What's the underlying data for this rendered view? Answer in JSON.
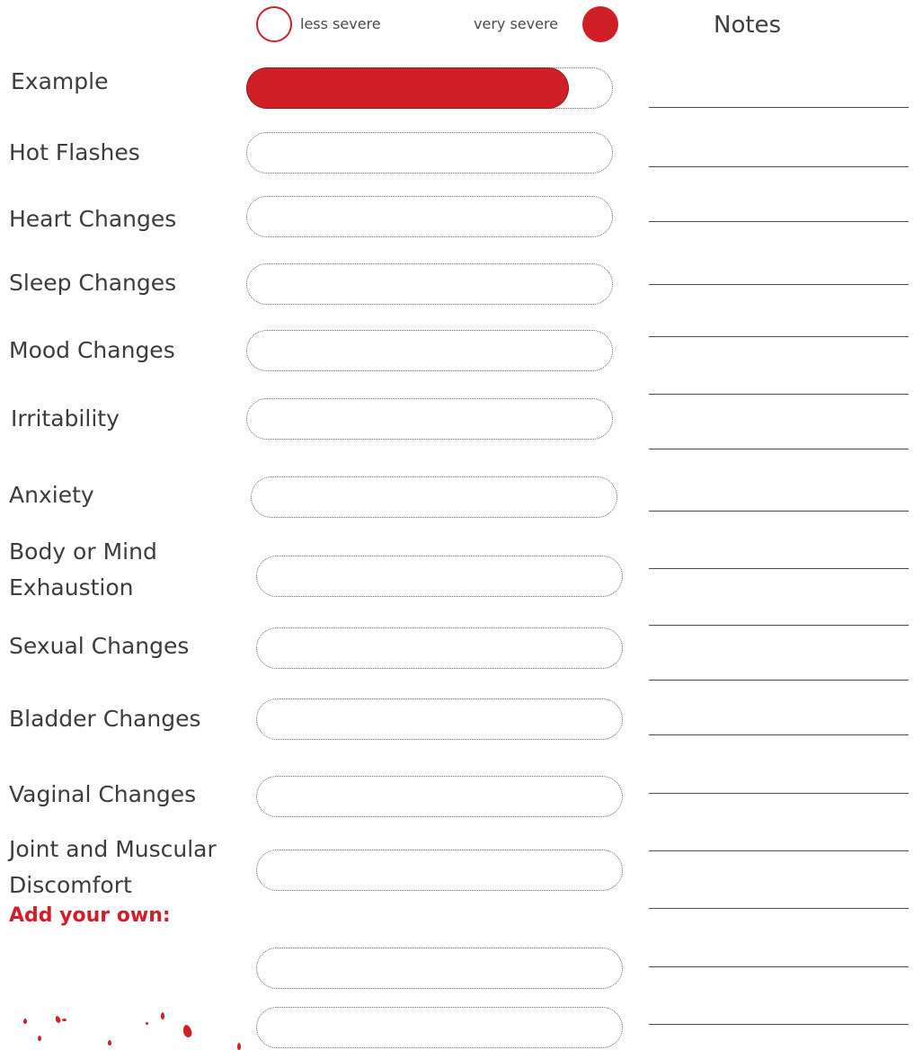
{
  "legend": {
    "less_label": "less severe",
    "very_label": "very severe",
    "accent_color": "#d11f27"
  },
  "notes_header": "Notes",
  "example": {
    "label": "Example",
    "severity_fraction": 0.88
  },
  "symptoms": [
    {
      "label": "Hot Flashes"
    },
    {
      "label": "Heart Changes"
    },
    {
      "label": "Sleep Changes"
    },
    {
      "label": "Mood Changes"
    },
    {
      "label": "Irritability"
    },
    {
      "label": "Anxiety"
    },
    {
      "label": "Body or Mind Exhaustion"
    },
    {
      "label": "Sexual Changes"
    },
    {
      "label": "Bladder Changes"
    },
    {
      "label": "Vaginal Changes"
    },
    {
      "label": "Joint and Muscular Discomfort"
    }
  ],
  "add_your_own": "Add your own:",
  "icons": [
    "less-severe-circle-icon",
    "very-severe-circle-icon",
    "petal-decoration-icon"
  ]
}
